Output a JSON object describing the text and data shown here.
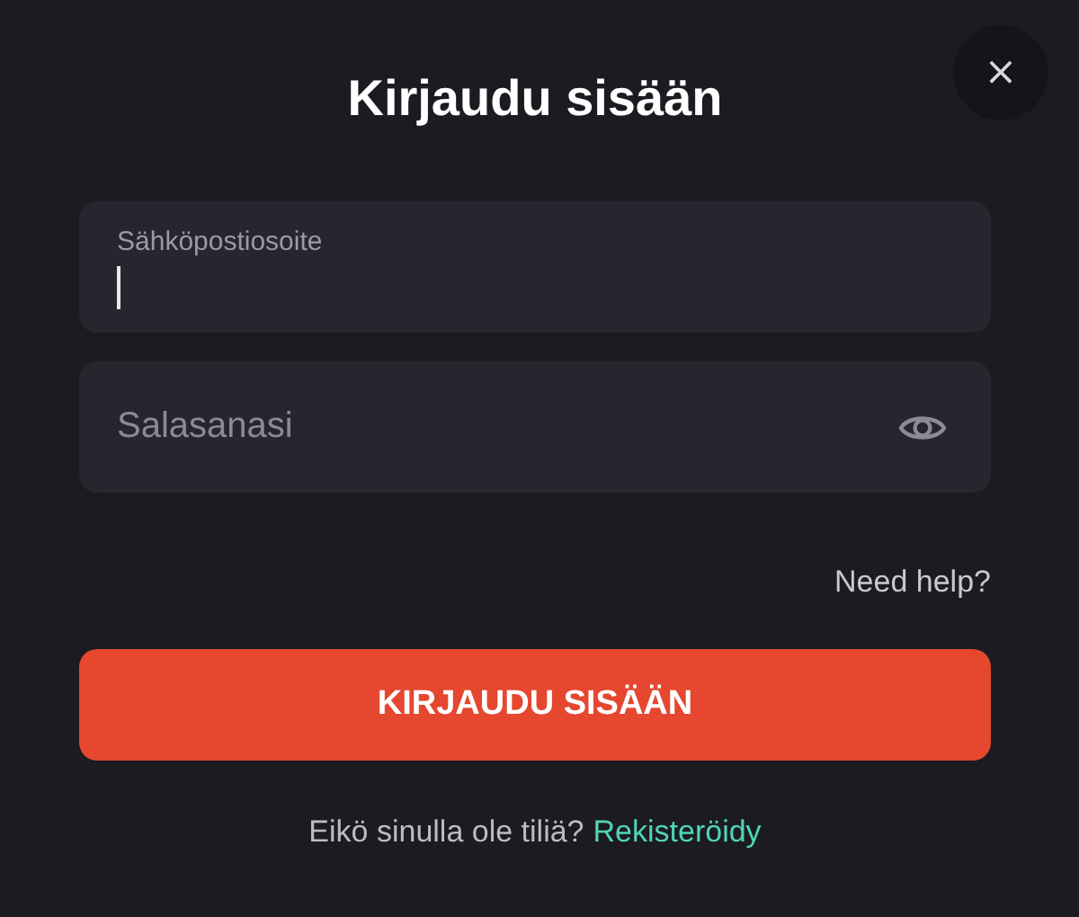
{
  "dialog": {
    "title": "Kirjaudu sisään",
    "close_icon": "×"
  },
  "fields": [
    {
      "kind": "email",
      "label": "Sähköpostiosoite",
      "focused": true
    },
    {
      "kind": "password",
      "placeholder": "Salasanasi",
      "focused": false
    }
  ],
  "help_link": "Need help?",
  "submit_button": "KIRJAUDU SISÄÄN",
  "footer": {
    "prompt": "Eikö sinulla ole tiliä?",
    "link": "Rekisteröidy"
  }
}
